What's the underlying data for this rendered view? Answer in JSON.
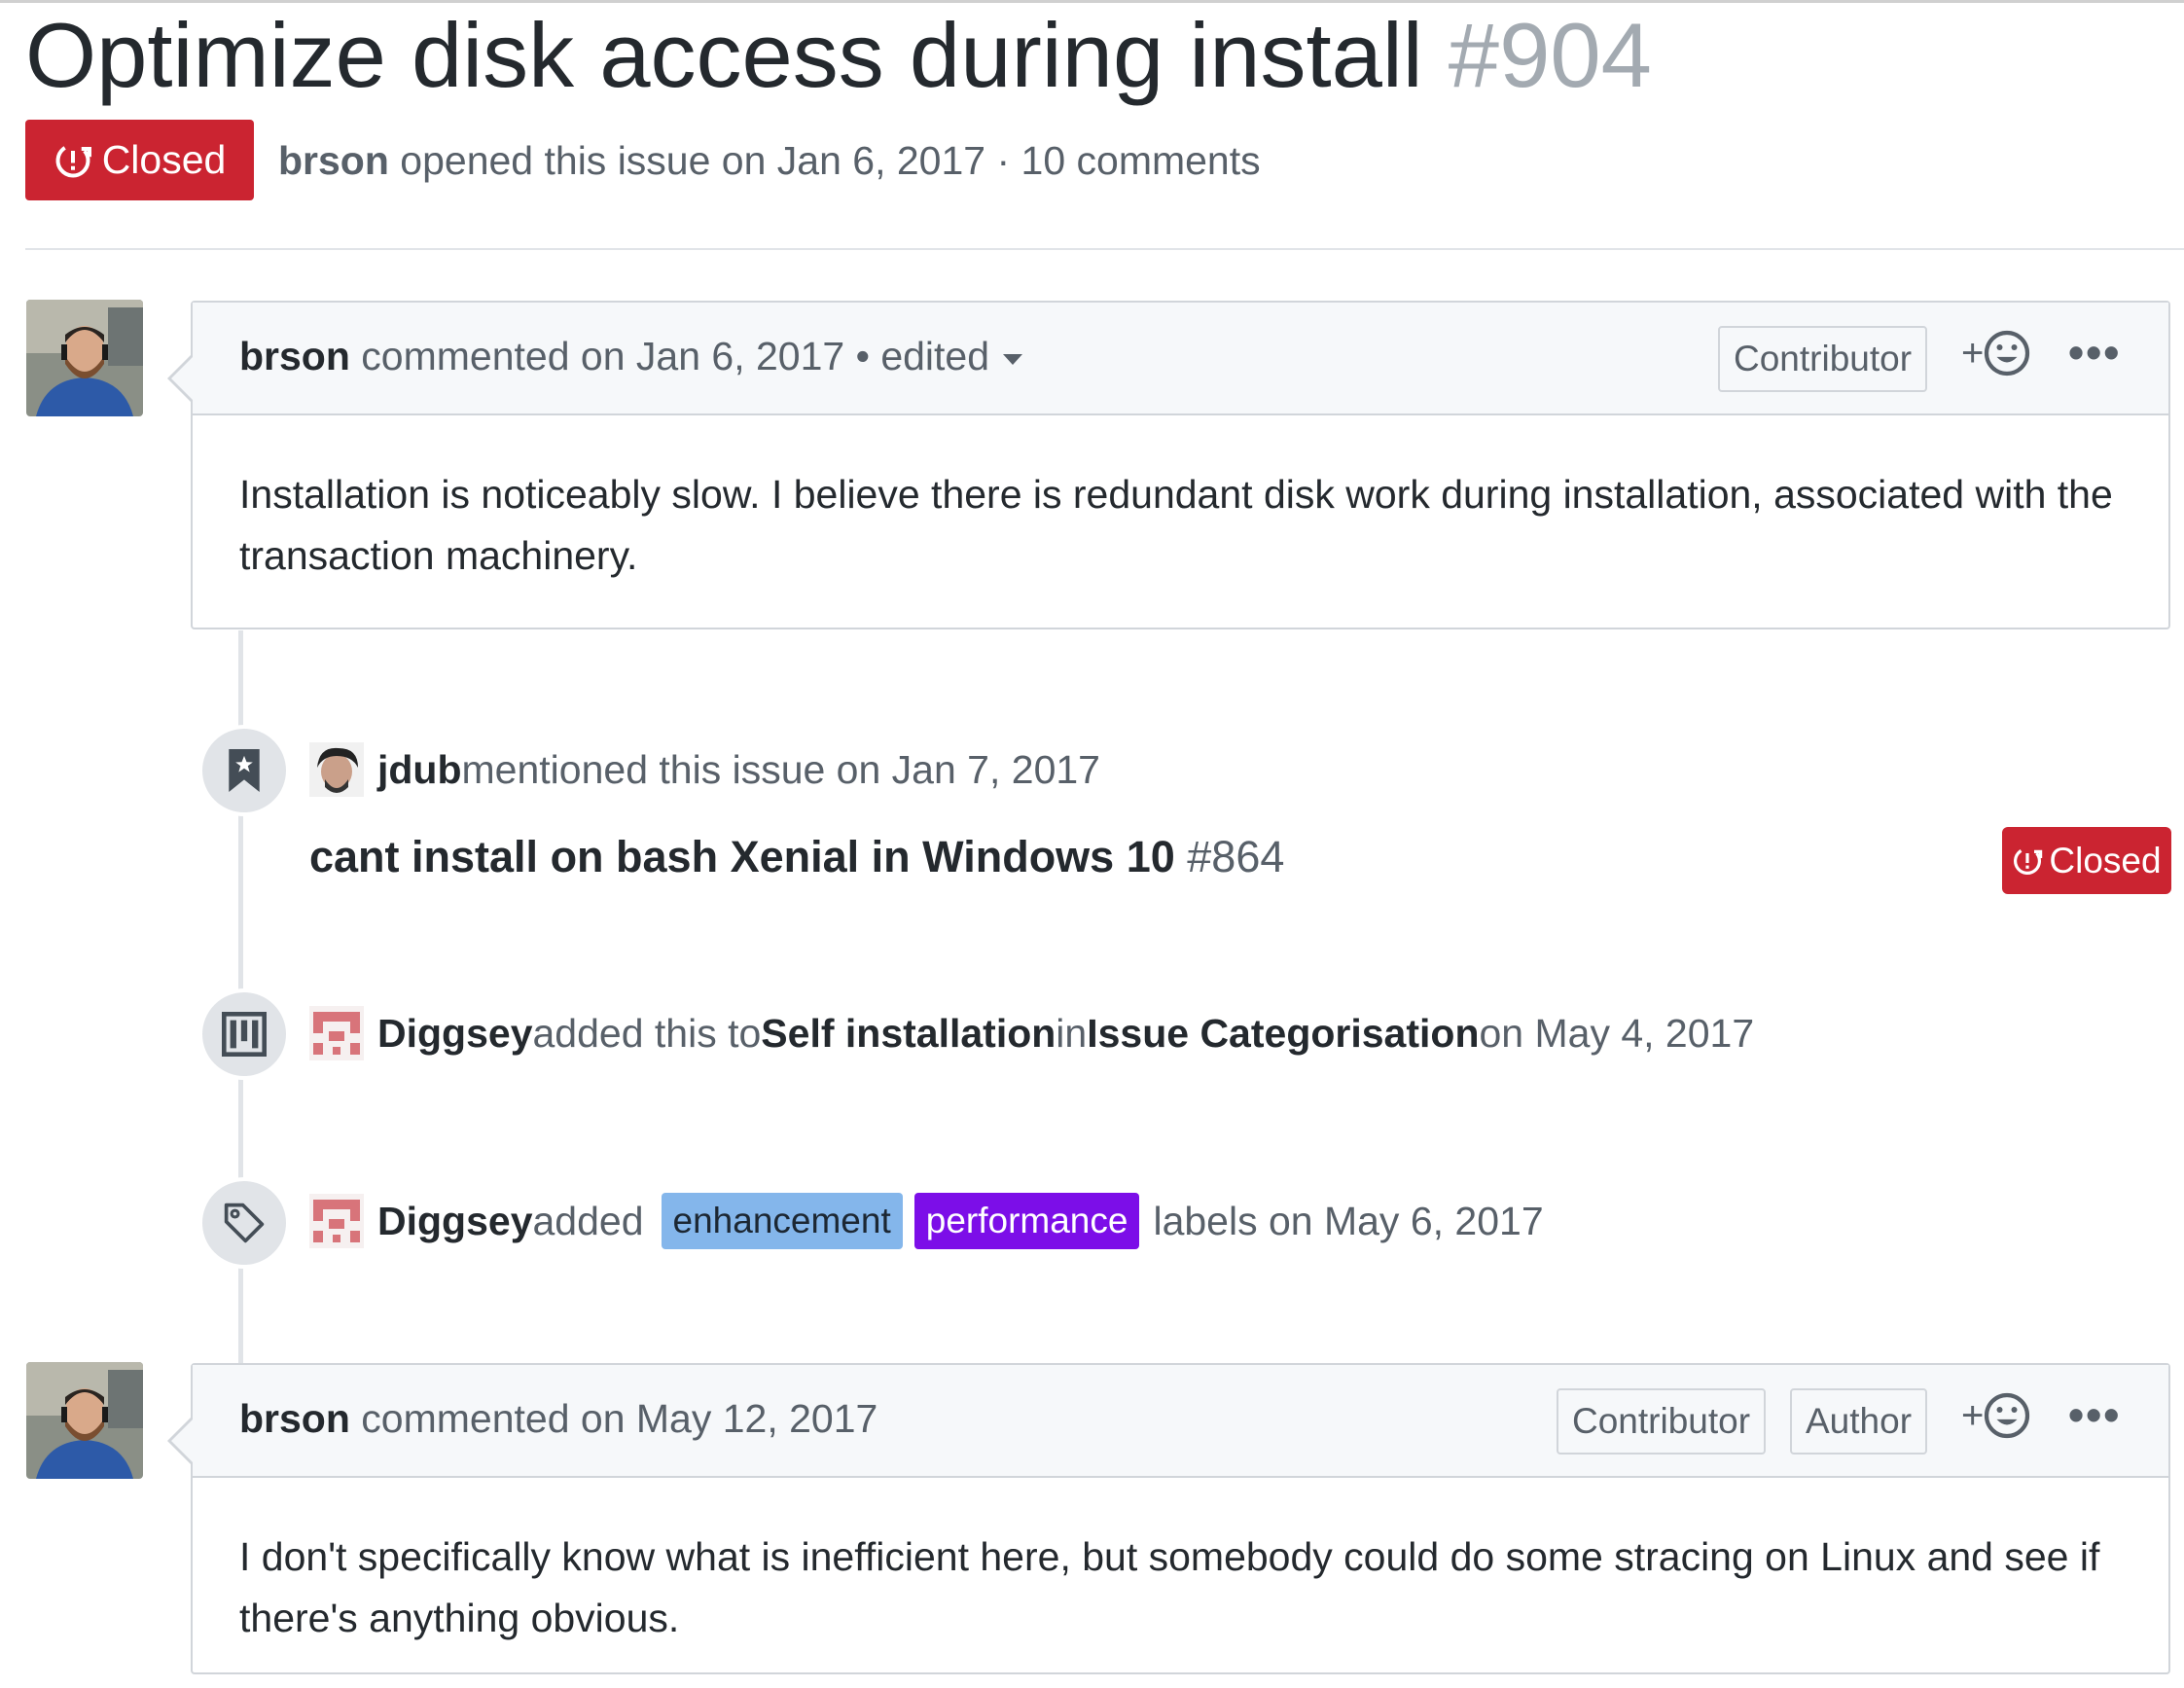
{
  "issue": {
    "title": "Optimize disk access during install",
    "number": "#904",
    "state": "Closed",
    "author": "brson",
    "meta_text": " opened this issue on Jan 6, 2017 · 10 comments"
  },
  "comments": [
    {
      "author": "brson",
      "action": " commented on Jan 6, 2017 • edited",
      "labels": [
        "Contributor"
      ],
      "reaction": "+",
      "more": "•••",
      "body": "Installation is noticeably slow. I believe there is redundant disk work during installation, associated with the transaction machinery."
    },
    {
      "author": "brson",
      "action": " commented on May 12, 2017",
      "labels": [
        "Contributor",
        "Author"
      ],
      "reaction": "+",
      "more": "•••",
      "body": "I don't specifically know what is inefficient here, but somebody could do some stracing on Linux and see if there's anything obvious."
    }
  ],
  "events": {
    "mention": {
      "actor": "jdub",
      "text": " mentioned this issue on Jan 7, 2017",
      "ref_title": "cant install on bash Xenial in Windows 10",
      "ref_number": "#864",
      "ref_state": "Closed"
    },
    "project": {
      "actor": "Diggsey",
      "text_added": " added this to ",
      "column": "Self installation",
      "text_in": " in ",
      "project": "Issue Categorisation",
      "date": " on May 4, 2017"
    },
    "labeled": {
      "actor": "Diggsey",
      "text_added": " added ",
      "labels": [
        {
          "name": "enhancement",
          "color": "#84b6eb"
        },
        {
          "name": "performance",
          "color": "#7c0ee8"
        }
      ],
      "text_after": "labels on May 6, 2017"
    }
  },
  "icons": {
    "state": "issue-closed-icon",
    "mention": "bookmark-icon",
    "project": "project-icon",
    "labeled": "tag-icon",
    "reaction": "smiley-icon",
    "more": "kebab-horizontal-icon"
  },
  "colors": {
    "closed_red": "#cb2431",
    "enhancement_label": "#84b6eb",
    "performance_label": "#7c0ee8"
  }
}
